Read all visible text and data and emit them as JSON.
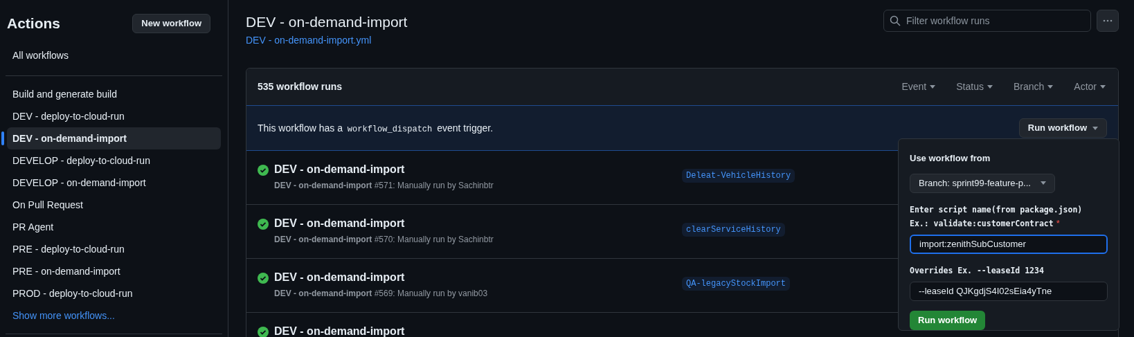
{
  "sidebar": {
    "title": "Actions",
    "new_button": "New workflow",
    "all_link": {
      "label": "All workflows",
      "selected": false
    },
    "items": [
      {
        "label": "Build and generate build",
        "selected": false
      },
      {
        "label": "DEV - deploy-to-cloud-run",
        "selected": false
      },
      {
        "label": "DEV - on-demand-import",
        "selected": true
      },
      {
        "label": "DEVELOP - deploy-to-cloud-run",
        "selected": false
      },
      {
        "label": "DEVELOP - on-demand-import",
        "selected": false
      },
      {
        "label": "On Pull Request",
        "selected": false
      },
      {
        "label": "PR Agent",
        "selected": false
      },
      {
        "label": "PRE - deploy-to-cloud-run",
        "selected": false
      },
      {
        "label": "PRE - on-demand-import",
        "selected": false
      },
      {
        "label": "PROD - deploy-to-cloud-run",
        "selected": false
      }
    ],
    "show_more": "Show more workflows..."
  },
  "header": {
    "title": "DEV - on-demand-import",
    "file_link": "DEV - on-demand-import.yml",
    "search": {
      "placeholder": "Filter workflow runs"
    }
  },
  "runs": {
    "count": "535 workflow runs",
    "filters": [
      "Event",
      "Status",
      "Branch",
      "Actor"
    ],
    "banner": {
      "before": "This workflow has a",
      "code": "workflow_dispatch",
      "after": "event trigger.",
      "button": "Run workflow"
    },
    "rows": [
      {
        "title": "DEV - on-demand-import",
        "subtitle": "**DEV - on-demand-import** #571: Manually run by Sachinbtr",
        "branch": "Deleat-VehicleHistory"
      },
      {
        "title": "DEV - on-demand-import",
        "subtitle": "**DEV - on-demand-import** #570: Manually run by Sachinbtr",
        "branch": "clearServiceHistory"
      },
      {
        "title": "DEV - on-demand-import",
        "subtitle": "**DEV - on-demand-import** #569: Manually run by vanib03",
        "branch": "QA-legacyStockImport"
      },
      {
        "title": "DEV - on-demand-import"
      }
    ]
  },
  "popover": {
    "heading": "Use workflow from",
    "branch_select": "Branch: sprint99-feature-p...",
    "fields": [
      {
        "label": "Enter script name(from package.json)",
        "label_2": "Ex.: validate:customerContract",
        "required_mark": "*",
        "value": "import:zenithSubCustomer",
        "focused": true
      },
      {
        "label": "Overrides Ex. --leaseId 1234",
        "value": "--leaseId QJKgdjS4I02sEia4yTne",
        "focused": false
      }
    ],
    "submit": "Run workflow"
  }
}
